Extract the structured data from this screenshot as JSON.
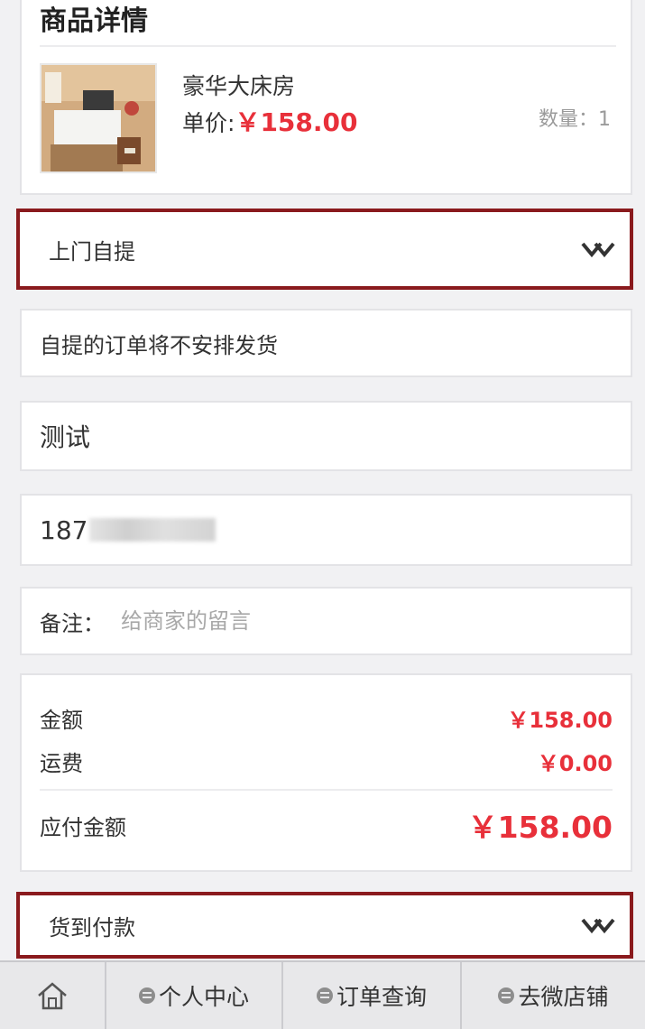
{
  "product": {
    "section_title": "商品详情",
    "name": "豪华大床房",
    "price_label": "单价:",
    "price": "￥158.00",
    "quantity_label": "数量：1"
  },
  "delivery": {
    "selected": "上门自提"
  },
  "notice": "自提的订单将不安排发货",
  "contact": {
    "name": "测试",
    "phone_visible": "187"
  },
  "remark": {
    "label": "备注：",
    "placeholder": "给商家的留言"
  },
  "summary": {
    "amount_label": "金额",
    "amount_value": "￥158.00",
    "shipping_label": "运费",
    "shipping_value": "￥0.00",
    "total_label": "应付金额",
    "total_value": "￥158.00"
  },
  "payment": {
    "selected": "货到付款"
  },
  "bottom_nav": {
    "personal_center": "个人中心",
    "order_query": "订单查询",
    "micro_store": "去微店铺"
  },
  "colors": {
    "accent_price": "#e8303a",
    "select_border": "#8a1a1d"
  },
  "icons": {
    "home": "home-icon",
    "chevron": "double-chevron-down-icon",
    "menu": "menu-dot-icon"
  }
}
